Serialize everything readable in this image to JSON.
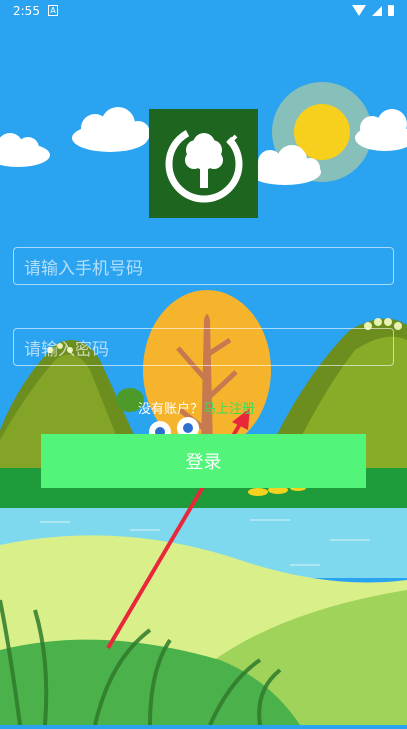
{
  "status_bar": {
    "time": "2:55",
    "notification_badge": "A"
  },
  "login": {
    "phone_placeholder": "请输入手机号码",
    "password_placeholder": "请输入密码",
    "no_account_text": "没有账户？",
    "register_link": "马上注册",
    "login_button": "登录"
  },
  "colors": {
    "sky": "#2aa3f0",
    "logo_bg": "#1e6620",
    "button": "#52f57a",
    "register_link": "#35e05a",
    "arrow": "#e8283a"
  }
}
